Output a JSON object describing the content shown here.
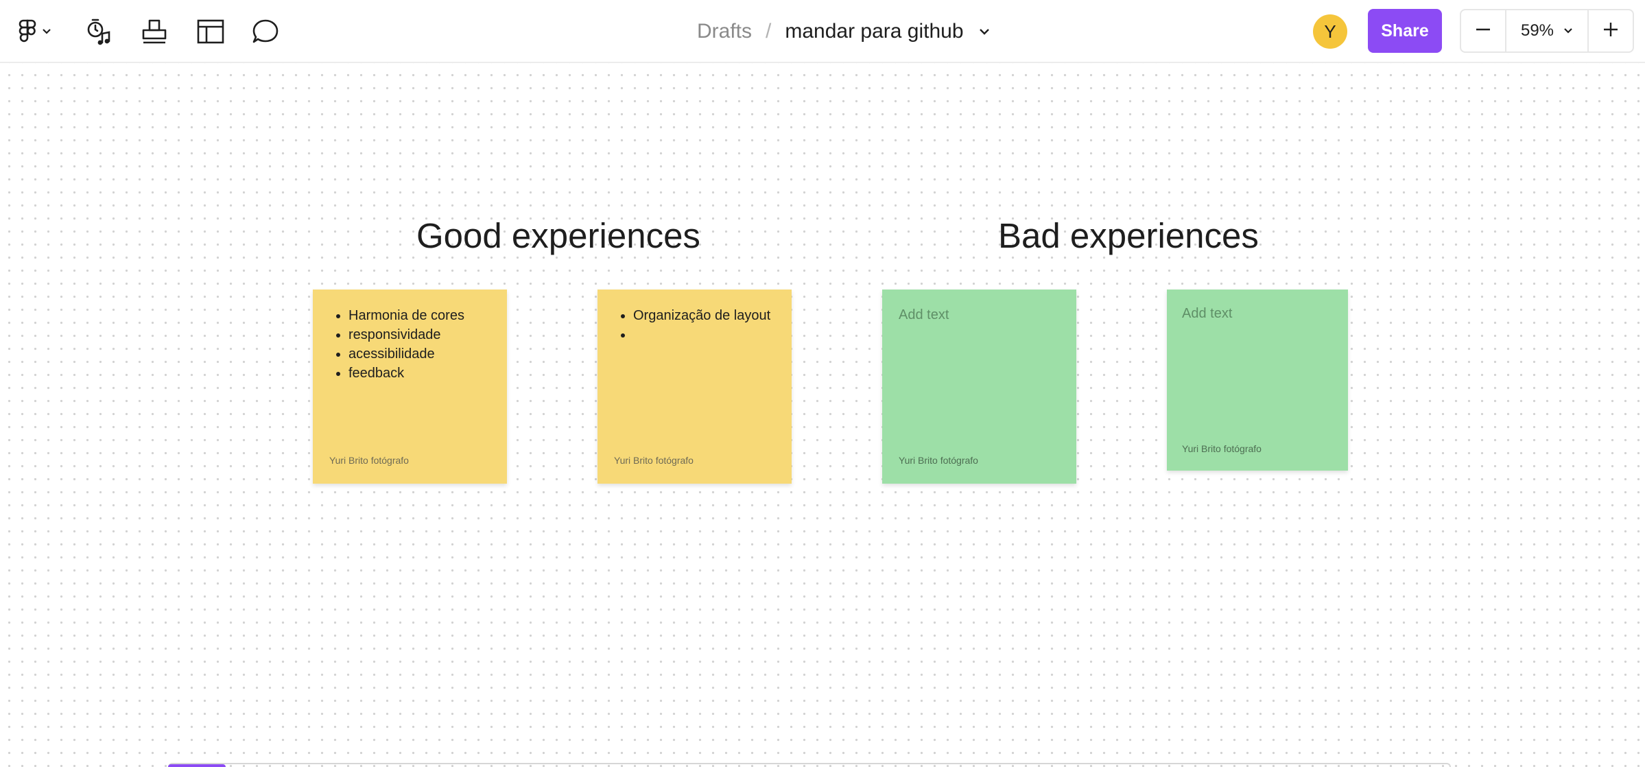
{
  "toolbar": {
    "icons": [
      "figma-logo-icon",
      "chevron-down-icon",
      "timer-music-icon",
      "stamp-icon",
      "layout-template-icon",
      "comment-icon"
    ]
  },
  "breadcrumb": {
    "root": "Drafts",
    "separator": "/",
    "file_name": "mandar para github"
  },
  "user": {
    "avatar_initial": "Y",
    "avatar_color": "#f5c53b"
  },
  "share": {
    "label": "Share",
    "color": "#8c4bf4"
  },
  "zoom": {
    "level": "59%"
  },
  "board": {
    "good_title": "Good experiences",
    "bad_title": "Bad experiences",
    "stickies": [
      {
        "color": "#f7d977",
        "items": [
          "Harmonia de cores",
          "responsividade",
          "acessibilidade",
          "feedback"
        ],
        "author": "Yuri Brito fotógrafo"
      },
      {
        "color": "#f7d977",
        "items": [
          "Organização de layout",
          ""
        ],
        "author": "Yuri Brito fotógrafo"
      },
      {
        "color": "#9ddfa7",
        "placeholder": "Add text",
        "author": "Yuri Brito fotógrafo"
      },
      {
        "color": "#9ddfa7",
        "placeholder": "Add text",
        "author": "Yuri Brito fotógrafo"
      }
    ]
  }
}
